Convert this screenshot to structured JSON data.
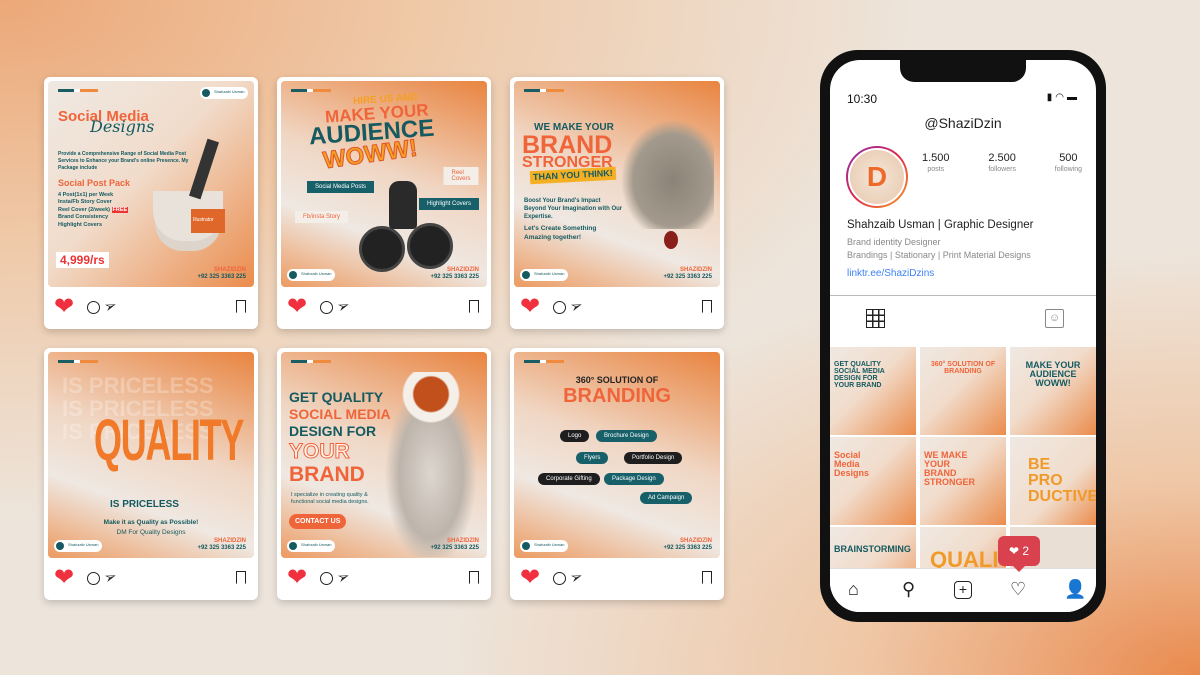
{
  "posts": [
    {
      "title1": "Social Media",
      "title2": "Designs",
      "desc": "Provide a Comprehensive Range of Social Media Post Services to Enhance your Brand's online Presence. My Package include",
      "pack": "Social Post Pack",
      "items": [
        "4 Post(1x1) per Week",
        "Insta/Fb Story Cover",
        "Reel Cover (2/week)",
        "Brand Consistency",
        "Highlight Covers"
      ],
      "free": "FREE",
      "price": "4,999/rs",
      "product": "Illustrator"
    },
    {
      "l1": "HIRE US AND",
      "l2": "MAKE YOUR",
      "l3": "AUDIENCE",
      "l4": "WOWW!",
      "tags": [
        "Reel Covers",
        "Social Media Posts",
        "Highlight Covers",
        "Fb/insta Story"
      ]
    },
    {
      "l1": "WE MAKE YOUR",
      "l2": "BRAND",
      "l3": "STRONGER",
      "l4": "THAN YOU THINK!",
      "p1": "Boost Your Brand's Impact Beyond Your Imagination with Our Expertise.",
      "p2": "Let's Create Something Amazing together!"
    },
    {
      "bg": "IS PRICELESS",
      "l1": "QUALITY",
      "l2": "IS PRICELESS",
      "p1": "Make it as Quality as Possible!",
      "p2": "DM For Quality Designs"
    },
    {
      "l1": "GET QUALITY",
      "l2": "SOCIAL MEDIA",
      "l3": "DESIGN FOR",
      "l4": "YOUR",
      "l5": "BRAND",
      "p": "I specialize in creating quality & functional social media designs.",
      "cta": "CONTACT US"
    },
    {
      "l1": "360° SOLUTION OF",
      "l2": "BRANDING",
      "chips": [
        "Logo",
        "Brochure Design",
        "Flyers",
        "Portfolio Design",
        "Corporate Gifting",
        "Package Design",
        "Ad Campaign"
      ]
    }
  ],
  "footer": {
    "handle": "SHAZIDZIN",
    "phone": "+92 325 3363 225",
    "badge": "Shahzaib Usman"
  },
  "phone": {
    "time": "10:30",
    "username": "@ShaziDzin",
    "stats": [
      {
        "n": "1.500",
        "l": "posts"
      },
      {
        "n": "2.500",
        "l": "followers"
      },
      {
        "n": "500",
        "l": "following"
      }
    ],
    "name": "Shahzaib Usman | Graphic Designer",
    "bio1": "Brand identity Designer",
    "bio2": "Brandings | Stationary | Print Material Designs",
    "link": "linktr.ee/ShaziDzins",
    "thumbs": [
      "GET QUALITY SOCIAL MEDIA DESIGN FOR YOUR BRAND",
      "360° SOLUTION OF BRANDING",
      "MAKE YOUR AUDIENCE WOWW!",
      "Social Media Designs",
      "WE MAKE YOUR BRAND STRONGER",
      "BE PRO DUCTIVE",
      "BRAINSTORMING",
      "QUALITY",
      ""
    ],
    "notif_count": "2"
  },
  "colors": {
    "accent": "#f0643a",
    "teal": "#145a60",
    "like": "#f0303e",
    "link": "#3b82f6"
  }
}
